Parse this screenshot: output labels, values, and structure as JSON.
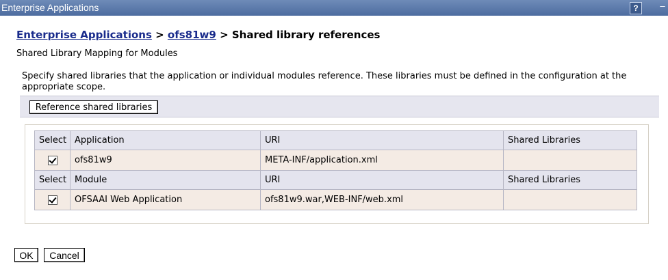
{
  "window": {
    "title": "Enterprise Applications",
    "help_label": "?",
    "minimize_label": "–"
  },
  "breadcrumb": {
    "items": [
      "Enterprise Applications",
      "ofs81w9"
    ],
    "separator": ">",
    "current": "Shared library references"
  },
  "subtitle": "Shared Library Mapping for Modules",
  "description": "Specify shared libraries that the application or individual modules reference. These libraries must be defined in the configuration at the appropriate scope.",
  "toolbar": {
    "reference_button_label": "Reference shared libraries"
  },
  "application_table": {
    "headers": [
      "Select",
      "Application",
      "URI",
      "Shared Libraries"
    ],
    "rows": [
      {
        "selected": true,
        "name": "ofs81w9",
        "uri": "META-INF/application.xml",
        "shared_libraries": ""
      }
    ]
  },
  "module_table": {
    "headers": [
      "Select",
      "Module",
      "URI",
      "Shared Libraries"
    ],
    "rows": [
      {
        "selected": true,
        "name": "OFSAAI Web Application",
        "uri": "ofs81w9.war,WEB-INF/web.xml",
        "shared_libraries": ""
      }
    ]
  },
  "footer": {
    "ok_label": "OK",
    "cancel_label": "Cancel"
  },
  "colors": {
    "titlebar": "#4d6c9f",
    "link": "#1a2c8c",
    "header_row": "#e4e4ee",
    "data_row": "#f4ebe4"
  }
}
